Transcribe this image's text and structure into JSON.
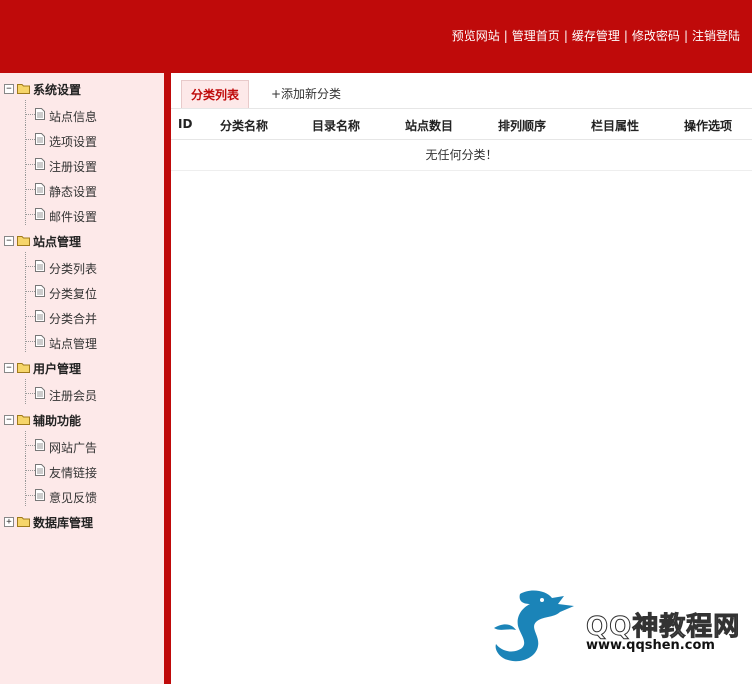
{
  "topnav": {
    "links": [
      "预览网站",
      "管理首页",
      "缓存管理",
      "修改密码",
      "注销登陆"
    ]
  },
  "sidebar": {
    "groups": [
      {
        "label": "系统设置",
        "expanded": true,
        "items": [
          "站点信息",
          "选项设置",
          "注册设置",
          "静态设置",
          "邮件设置"
        ]
      },
      {
        "label": "站点管理",
        "expanded": true,
        "items": [
          "分类列表",
          "分类复位",
          "分类合并",
          "站点管理"
        ]
      },
      {
        "label": "用户管理",
        "expanded": true,
        "items": [
          "注册会员"
        ]
      },
      {
        "label": "辅助功能",
        "expanded": true,
        "items": [
          "网站广告",
          "友情链接",
          "意见反馈"
        ]
      },
      {
        "label": "数据库管理",
        "expanded": false,
        "items": []
      }
    ]
  },
  "main": {
    "tabs": {
      "active": "分类列表",
      "add": "+添加新分类"
    },
    "columns": [
      "ID",
      "分类名称",
      "目录名称",
      "站点数目",
      "排列顺序",
      "栏目属性",
      "操作选项"
    ],
    "empty_message": "无任何分类！"
  },
  "watermark": {
    "text": "QQ神教程网",
    "url": "www.qqshen.com"
  },
  "colors": {
    "accent": "#bf0a0a",
    "sidebar_bg": "#fde9e9"
  }
}
